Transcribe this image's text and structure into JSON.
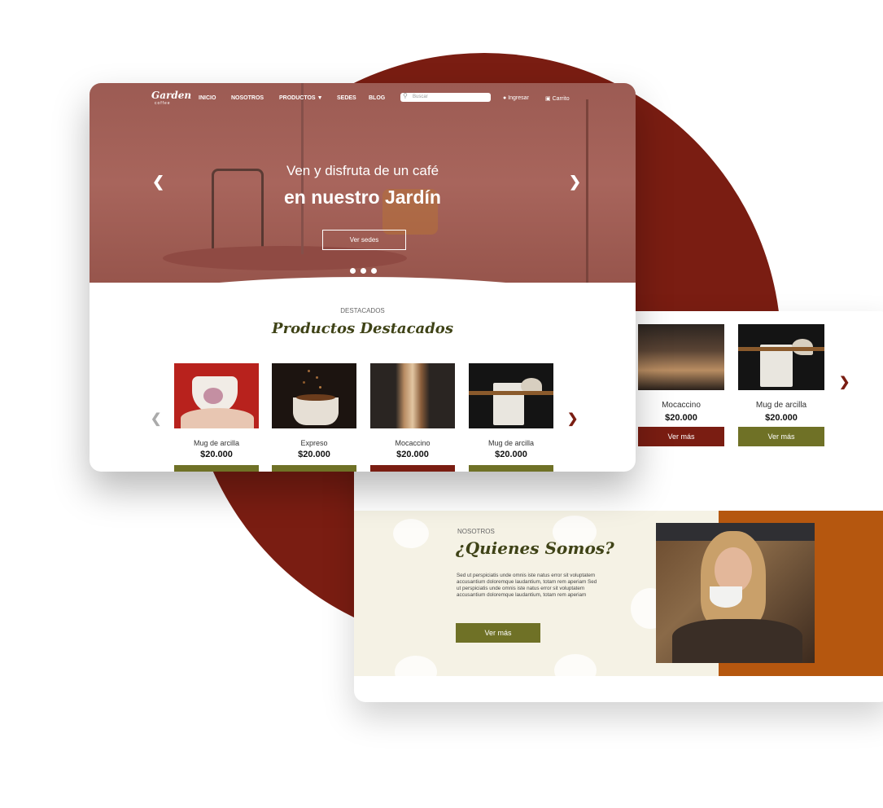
{
  "brand": {
    "logo_main": "Garden",
    "logo_sub": "coffee",
    "colors": {
      "maroon": "#7a1d12",
      "olive": "#6f7126",
      "orange": "#b5570f",
      "cream": "#f5f2e5"
    }
  },
  "nav": {
    "items": [
      "INICIO",
      "NOSOTROS",
      "PRODUCTOS",
      "SEDES",
      "BLOG"
    ],
    "products_dropdown_icon": "chevron-down-icon",
    "search_placeholder": "Buscar",
    "login": "Ingresar",
    "cart": "Carrito"
  },
  "hero": {
    "subtitle": "Ven y disfruta de un café",
    "title": "en nuestro Jardín",
    "button": "Ver sedes",
    "prev_icon": "chevron-left-icon",
    "next_icon": "chevron-right-icon",
    "slides": 3
  },
  "featured": {
    "kicker": "DESTACADOS",
    "title": "Productos Destacados",
    "products": [
      {
        "name": "Mug de arcilla",
        "price": "$20.000",
        "button_color": "#6f7126"
      },
      {
        "name": "Expreso",
        "price": "$20.000",
        "button_color": "#6f7126"
      },
      {
        "name": "Mocaccino",
        "price": "$20.000",
        "button_color": "#7a1d12"
      },
      {
        "name": "Mug de arcilla",
        "price": "$20.000",
        "button_color": "#6f7126"
      }
    ]
  },
  "back_products": [
    {
      "name": "Mocaccino",
      "price": "$20.000",
      "button": "Ver más",
      "button_color": "#7a1d12"
    },
    {
      "name": "Mug de arcilla",
      "price": "$20.000",
      "button": "Ver más",
      "button_color": "#6f7126"
    }
  ],
  "about": {
    "kicker": "NOSOTROS",
    "title": "¿Quienes Somos?",
    "body": "Sed ut perspiciatis unde omnis iste natus error sit voluptatem accusantium doloremque laudantium, totam rem aperiam Sed ut perspiciatis unde omnis iste natus error sit voluptatem accusantium doloremque laudantium, totam rem aperiam",
    "button": "Ver más"
  }
}
